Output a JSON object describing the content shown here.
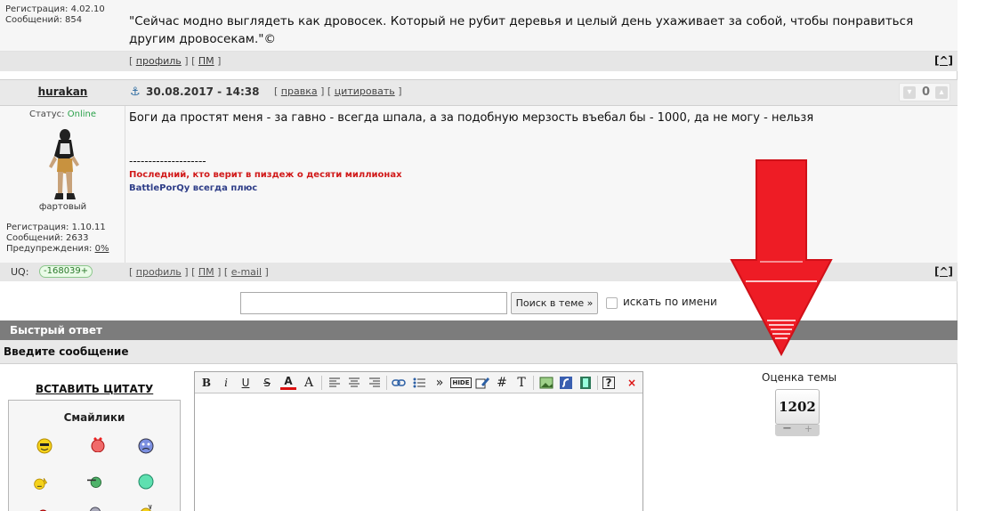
{
  "prev_post": {
    "registration": "Регистрация: 4.02.10",
    "messages": "Сообщений: 854",
    "quote": "\"Сейчас модно выглядеть как дровосек. Который не рубит деревья и целый день ухаживает за собой, чтобы понравиться другим дровосекам.\"©"
  },
  "bar_links": {
    "open": "[",
    "profile": "профиль",
    "mid": "] [",
    "pm": "ПМ",
    "close": "]",
    "email": "e-mail",
    "up": "[^]"
  },
  "post": {
    "author": "hurakan",
    "anchor": "⚓",
    "date": "30.08.2017 - 14:38",
    "edit": "правка",
    "quote_link": "цитировать",
    "rating": "0",
    "text": "Боги да простят меня - за гавно - всегда шпала, а за подобную мерзость въебал бы - 1000, да не могу - нельзя",
    "sig_dash": "--------------------",
    "sig_red": "Последний, кто верит в пиздеж о десяти миллионах",
    "sig_blue": "BattlePorQy всегда плюс"
  },
  "user": {
    "status_label": "Статус:",
    "status_value": "Online",
    "rank": "фартовый",
    "registration": "Регистрация: 1.10.11",
    "messages": "Сообщений: 2633",
    "warnings_label": "Предупреждения: ",
    "warnings_value": "0%",
    "uq_label": "UQ:",
    "uq_value": "-168039+"
  },
  "search": {
    "input_value": "",
    "button": "Поиск в теме »",
    "checkbox_label": "искать по имени"
  },
  "quick_reply": {
    "title": "Быстрый ответ",
    "subtitle": "Введите сообщение",
    "insert_quote": "ВСТАВИТЬ ЦИТАТУ",
    "smilies_title": "Смайлики"
  },
  "toolbar": {
    "bold": "B",
    "italic": "i",
    "underline": "U",
    "strike": "S",
    "color": "A",
    "size": "A",
    "quote_symbol": "»",
    "hide": "HIDE",
    "hash": "#",
    "font": "T",
    "help": "?",
    "close": "×"
  },
  "topic_rating": {
    "title": "Оценка темы",
    "value": "1202",
    "minus": "−",
    "plus": "+"
  },
  "colors": {
    "arrow": "#ee1c25",
    "online": "#2aa14a",
    "quick_reply_bar": "#7c7c7c"
  }
}
